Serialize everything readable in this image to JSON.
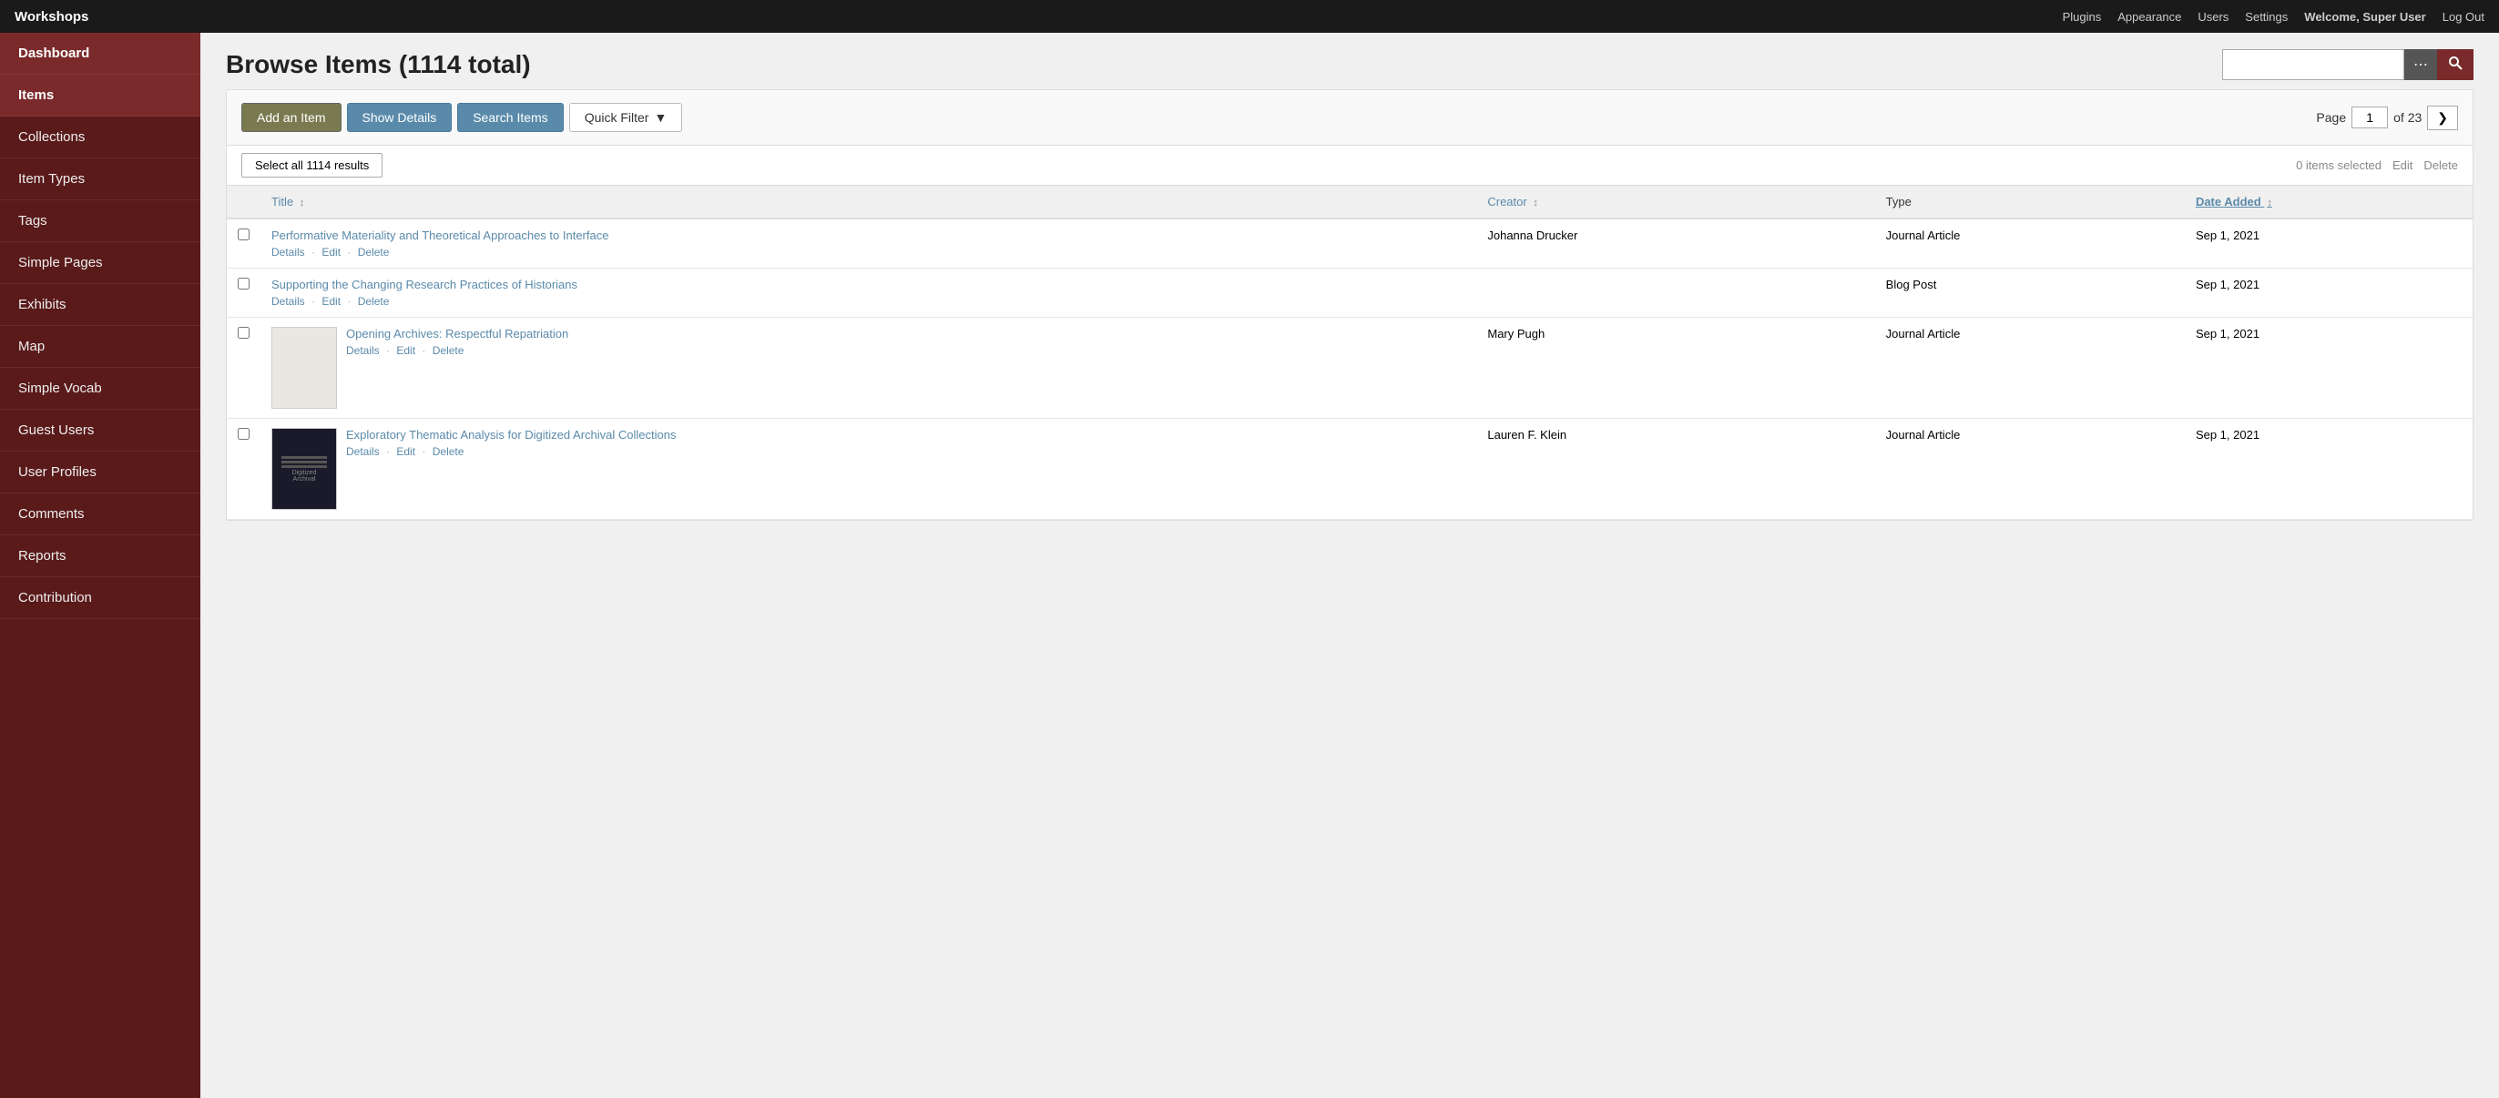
{
  "topbar": {
    "logo": "Workshops",
    "nav_items": [
      "Plugins",
      "Appearance",
      "Users",
      "Settings"
    ],
    "welcome_text": "Welcome,",
    "username": "Super User",
    "logout": "Log Out"
  },
  "sidebar": {
    "items": [
      {
        "id": "dashboard",
        "label": "Dashboard",
        "active": false
      },
      {
        "id": "items",
        "label": "Items",
        "active": true
      },
      {
        "id": "collections",
        "label": "Collections",
        "active": false
      },
      {
        "id": "item-types",
        "label": "Item Types",
        "active": false
      },
      {
        "id": "tags",
        "label": "Tags",
        "active": false
      },
      {
        "id": "simple-pages",
        "label": "Simple Pages",
        "active": false
      },
      {
        "id": "exhibits",
        "label": "Exhibits",
        "active": false
      },
      {
        "id": "map",
        "label": "Map",
        "active": false
      },
      {
        "id": "simple-vocab",
        "label": "Simple Vocab",
        "active": false
      },
      {
        "id": "guest-users",
        "label": "Guest Users",
        "active": false
      },
      {
        "id": "user-profiles",
        "label": "User Profiles",
        "active": false
      },
      {
        "id": "comments",
        "label": "Comments",
        "active": false
      },
      {
        "id": "reports",
        "label": "Reports",
        "active": false
      },
      {
        "id": "contribution",
        "label": "Contribution",
        "active": false
      }
    ]
  },
  "main": {
    "page_title": "Browse Items (1114 total)",
    "search_placeholder": "",
    "toolbar": {
      "add_label": "Add an Item",
      "show_details_label": "Show Details",
      "search_items_label": "Search Items",
      "quick_filter_label": "Quick Filter"
    },
    "pagination": {
      "label": "Page",
      "current": "1",
      "total": "of 23"
    },
    "select_bar": {
      "select_all_label": "Select all 1114 results",
      "items_selected": "0 items selected",
      "edit_label": "Edit",
      "delete_label": "Delete"
    },
    "table": {
      "headers": [
        {
          "id": "title",
          "label": "Title",
          "sortable": true,
          "active": false
        },
        {
          "id": "creator",
          "label": "Creator",
          "sortable": true,
          "active": false
        },
        {
          "id": "type",
          "label": "Type",
          "sortable": false,
          "active": false
        },
        {
          "id": "date_added",
          "label": "Date Added",
          "sortable": true,
          "active": true
        }
      ],
      "rows": [
        {
          "id": "row1",
          "has_thumbnail": false,
          "thumbnail_type": "none",
          "title": "Performative Materiality and Theoretical Approaches to Interface",
          "title_link": "#",
          "creator": "Johanna Drucker",
          "type": "Journal Article",
          "date_added": "Sep 1, 2021",
          "actions": [
            "Details",
            "Edit",
            "Delete"
          ]
        },
        {
          "id": "row2",
          "has_thumbnail": false,
          "thumbnail_type": "none",
          "title": "Supporting the Changing Research Practices of Historians",
          "title_link": "#",
          "creator": "",
          "type": "Blog Post",
          "date_added": "Sep 1, 2021",
          "actions": [
            "Details",
            "Edit",
            "Delete"
          ]
        },
        {
          "id": "row3",
          "has_thumbnail": true,
          "thumbnail_type": "light",
          "title": "Opening Archives: Respectful Repatriation",
          "title_link": "#",
          "creator": "Mary Pugh",
          "type": "Journal Article",
          "date_added": "Sep 1, 2021",
          "actions": [
            "Details",
            "Edit",
            "Delete"
          ]
        },
        {
          "id": "row4",
          "has_thumbnail": true,
          "thumbnail_type": "dark",
          "title": "Exploratory Thematic Analysis for Digitized Archival Collections",
          "title_link": "#",
          "creator": "Lauren F. Klein",
          "type": "Journal Article",
          "date_added": "Sep 1, 2021",
          "actions": [
            "Details",
            "Edit",
            "Delete"
          ]
        }
      ]
    }
  }
}
